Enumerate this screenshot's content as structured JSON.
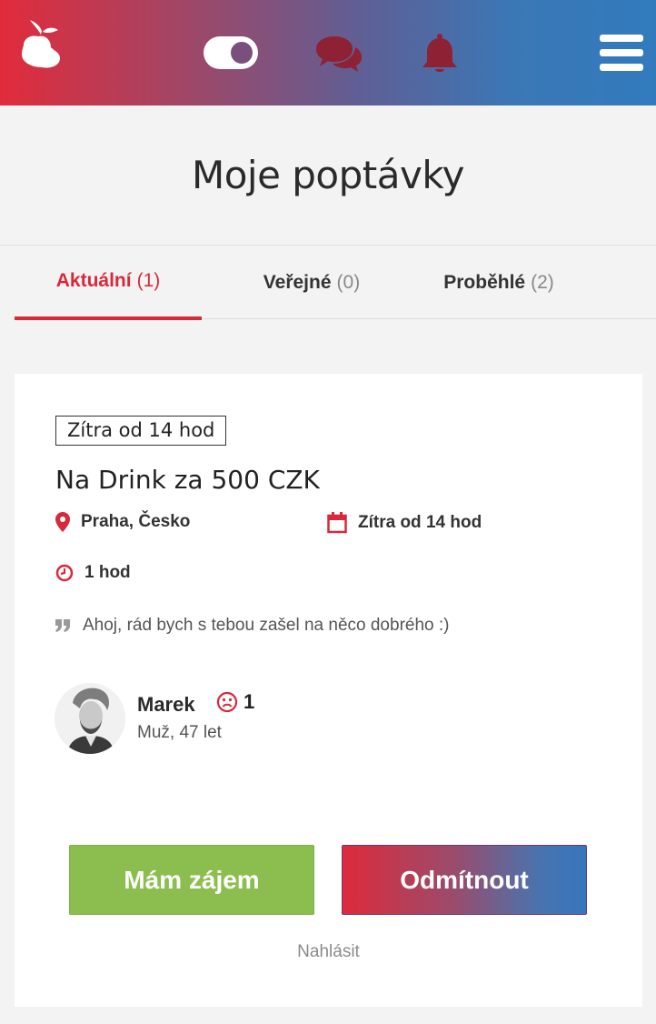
{
  "header": {
    "logo_icon": "pear-logo-icon",
    "toggle_icon": "toggle-icon",
    "chat_icon": "chat-bubbles-icon",
    "bell_icon": "bell-icon",
    "menu_icon": "hamburger-menu-icon",
    "colors": {
      "start": "#e12b3b",
      "end": "#317bbd",
      "icon_dark": "#8e2134"
    }
  },
  "page": {
    "title": "Moje poptávky"
  },
  "tabs": [
    {
      "label": "Aktuální",
      "count": "(1)",
      "active": true
    },
    {
      "label": "Veřejné",
      "count": "(0)",
      "active": false
    },
    {
      "label": "Proběhlé",
      "count": "(2)",
      "active": false
    }
  ],
  "card": {
    "badge": "Zítra od 14 hod",
    "title": "Na Drink za 500 CZK",
    "location": "Praha, Česko",
    "date": "Zítra od 14 hod",
    "duration": "1 hod",
    "message": "Ahoj, rád bych s tebou zašel na něco dobrého :)",
    "user": {
      "name": "Marek",
      "rating": "1",
      "subtitle": "Muž, 47 let",
      "rating_icon": "sad-face-icon"
    },
    "accept_label": "Mám zájem",
    "reject_label": "Odmítnout",
    "report_label": "Nahlásit"
  },
  "colors": {
    "accent": "#d8293a",
    "accept": "#8bbe4e"
  }
}
